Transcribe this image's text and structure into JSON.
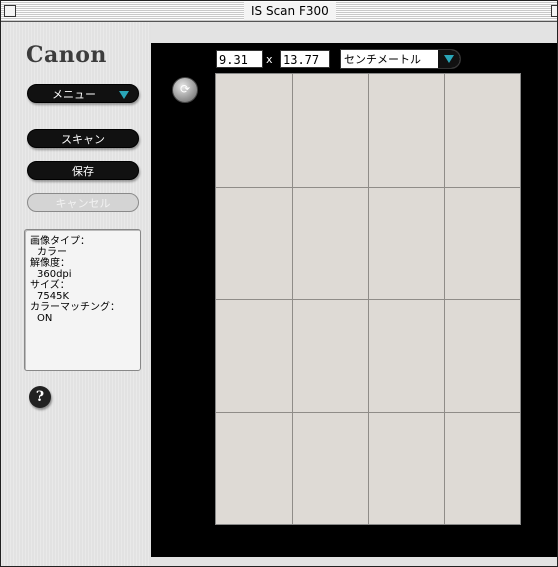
{
  "window": {
    "title": "IS Scan F300"
  },
  "sidebar": {
    "logo": "Canon",
    "menu_label": "メニュー",
    "scan_label": "スキャン",
    "save_label": "保存",
    "cancel_label": "キャンセル",
    "info": {
      "image_type_label": "画像タイプ：",
      "image_type_value": "カラー",
      "resolution_label": "解像度：",
      "resolution_value": "360dpi",
      "size_label": "サイズ：",
      "size_value": "7545K",
      "color_matching_label": "カラーマッチング：",
      "color_matching_value": "ON"
    },
    "help_glyph": "?"
  },
  "preview": {
    "width_value": "9.31",
    "separator": "x",
    "height_value": "13.77",
    "unit_selected": "センチメートル",
    "rotate_glyph": "⟳",
    "grid_columns": 4,
    "grid_rows": 4
  },
  "colors": {
    "preview_background": "#000000",
    "scan_area": "#dedad5",
    "accent_arrow": "#2aa6b8"
  }
}
